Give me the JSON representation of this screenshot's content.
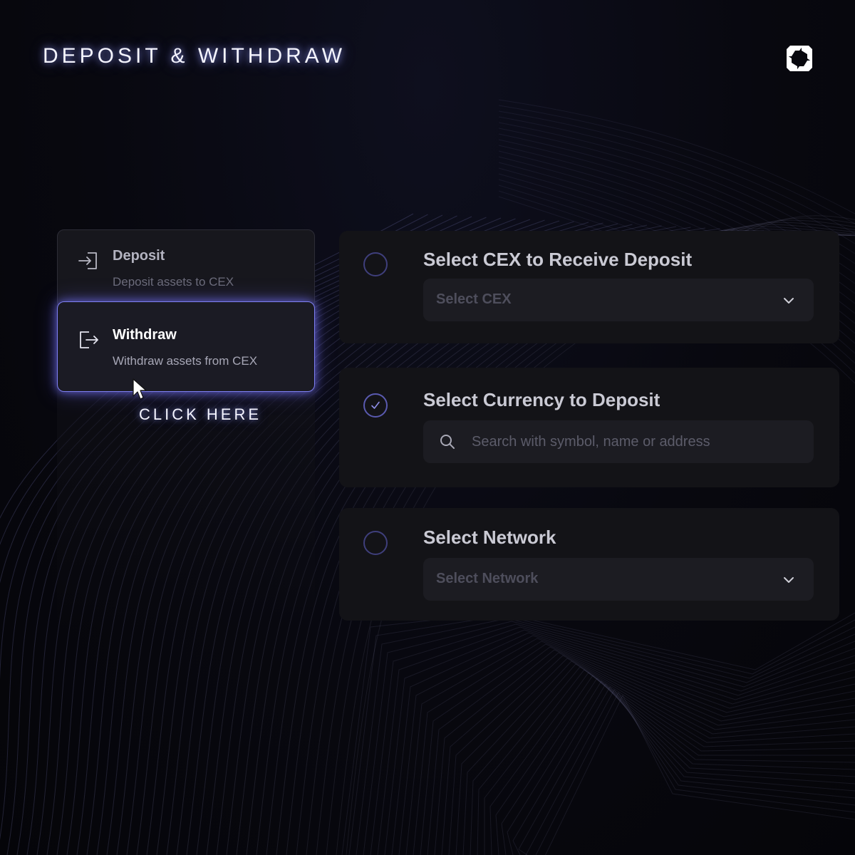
{
  "header": {
    "title": "DEPOSIT & WITHDRAW",
    "logo_icon": "brand-logo-icon"
  },
  "sidebar": {
    "options": [
      {
        "label": "Deposit",
        "description": "Deposit assets to CEX",
        "icon": "sign-in-icon",
        "state": "default"
      },
      {
        "label": "Withdraw",
        "description": "Withdraw assets from CEX",
        "icon": "sign-out-icon",
        "state": "highlighted"
      }
    ],
    "callout": "CLICK HERE"
  },
  "steps": [
    {
      "title": "Select CEX to Receive Deposit",
      "field": {
        "type": "select",
        "value": "Select CEX"
      },
      "checked": false
    },
    {
      "title": "Select Currency to Deposit",
      "field": {
        "type": "search",
        "placeholder": "Search with symbol, name or address"
      },
      "checked": true
    },
    {
      "title": "Select Network",
      "field": {
        "type": "select",
        "value": "Select Network"
      },
      "checked": false
    }
  ],
  "colors": {
    "accent": "#7e7ff2",
    "background": "#08080f",
    "card": "#131317",
    "field": "#1c1c22"
  }
}
